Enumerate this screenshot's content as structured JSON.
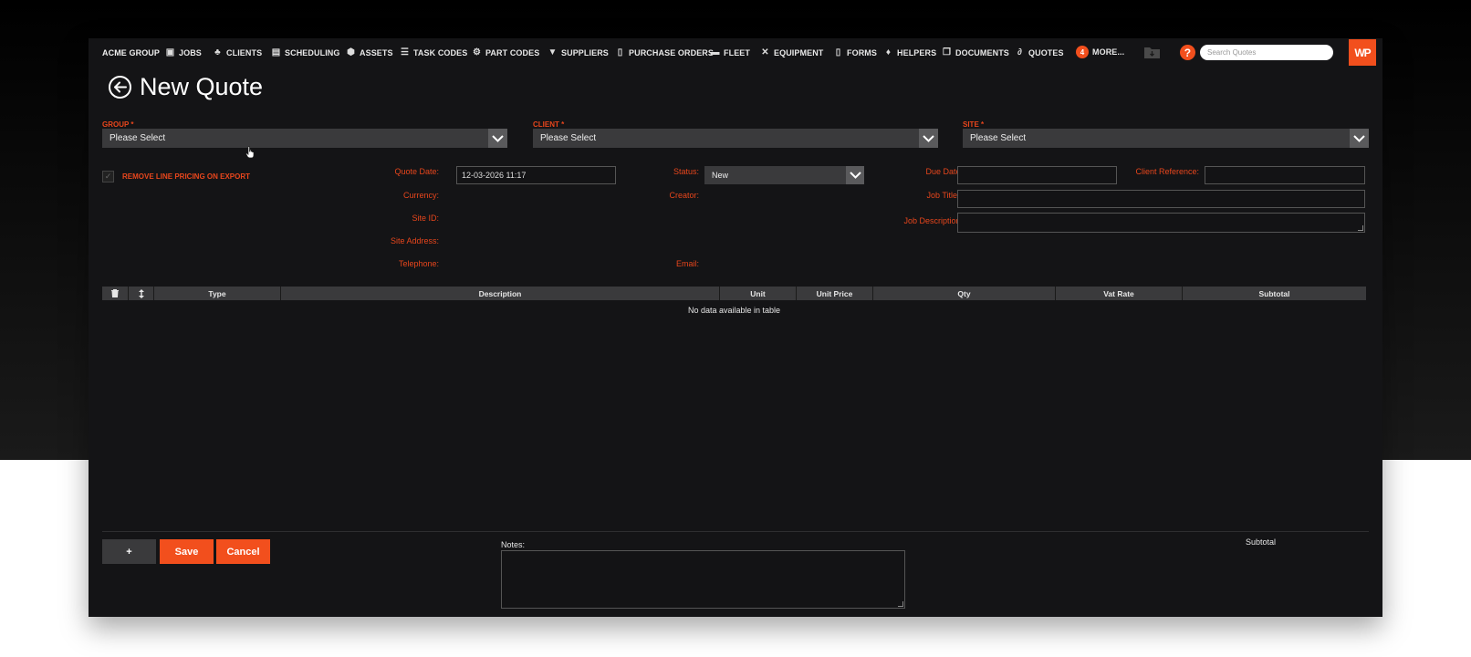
{
  "nav": {
    "brand": "ACME GROUP",
    "items": [
      {
        "label": "JOBS",
        "icon": "briefcase-icon",
        "glyph": "▣"
      },
      {
        "label": "CLIENTS",
        "icon": "sitemap-icon",
        "glyph": "♣"
      },
      {
        "label": "SCHEDULING",
        "icon": "calendar-icon",
        "glyph": "▤"
      },
      {
        "label": "ASSETS",
        "icon": "cube-icon",
        "glyph": "⬢"
      },
      {
        "label": "TASK CODES",
        "icon": "checklist-icon",
        "glyph": "☰"
      },
      {
        "label": "PART CODES",
        "icon": "cogs-icon",
        "glyph": "⚙"
      },
      {
        "label": "SUPPLIERS",
        "icon": "cart-icon",
        "glyph": "▼"
      },
      {
        "label": "PURCHASE ORDERS",
        "icon": "file-icon",
        "glyph": "▯"
      },
      {
        "label": "FLEET",
        "icon": "truck-icon",
        "glyph": "▬"
      },
      {
        "label": "EQUIPMENT",
        "icon": "tools-icon",
        "glyph": "✕"
      },
      {
        "label": "FORMS",
        "icon": "clipboard-icon",
        "glyph": "▯"
      },
      {
        "label": "HELPERS",
        "icon": "dolly-icon",
        "glyph": "♦"
      },
      {
        "label": "DOCUMENTS",
        "icon": "copy-icon",
        "glyph": "❐"
      },
      {
        "label": "QUOTES",
        "icon": "paperclip-icon",
        "glyph": "∂"
      }
    ],
    "more_count": "4",
    "more_label": "MORE...",
    "help_glyph": "?",
    "search_placeholder": "Search Quotes",
    "logo_text": "WP"
  },
  "page": {
    "title": "New Quote"
  },
  "selects": {
    "group": {
      "label": "GROUP *",
      "value": "Please Select"
    },
    "client": {
      "label": "CLIENT *",
      "value": "Please Select"
    },
    "site": {
      "label": "SITE *",
      "value": "Please Select"
    }
  },
  "form": {
    "remove_pricing_label": "REMOVE LINE PRICING ON EXPORT",
    "quote_date_label": "Quote Date:",
    "quote_date_value": "12-03-2026 11:17",
    "currency_label": "Currency:",
    "site_id_label": "Site ID:",
    "site_address_label": "Site Address:",
    "telephone_label": "Telephone:",
    "status_label": "Status:",
    "status_value": "New",
    "creator_label": "Creator:",
    "email_label": "Email:",
    "due_date_label": "Due Date:",
    "client_reference_label": "Client Reference:",
    "job_title_label": "Job Title:*",
    "job_description_label": "Job Description:"
  },
  "table": {
    "columns": [
      "Type",
      "Description",
      "Unit",
      "Unit Price",
      "Qty",
      "Vat Rate",
      "Subtotal"
    ],
    "empty_text": "No data available in table"
  },
  "footer": {
    "add_label": "+",
    "save_label": "Save",
    "cancel_label": "Cancel",
    "notes_label": "Notes:",
    "subtotal_label": "Subtotal"
  },
  "colors": {
    "accent": "#f24f1d",
    "panel": "#141416",
    "control": "#3a3a3c"
  }
}
